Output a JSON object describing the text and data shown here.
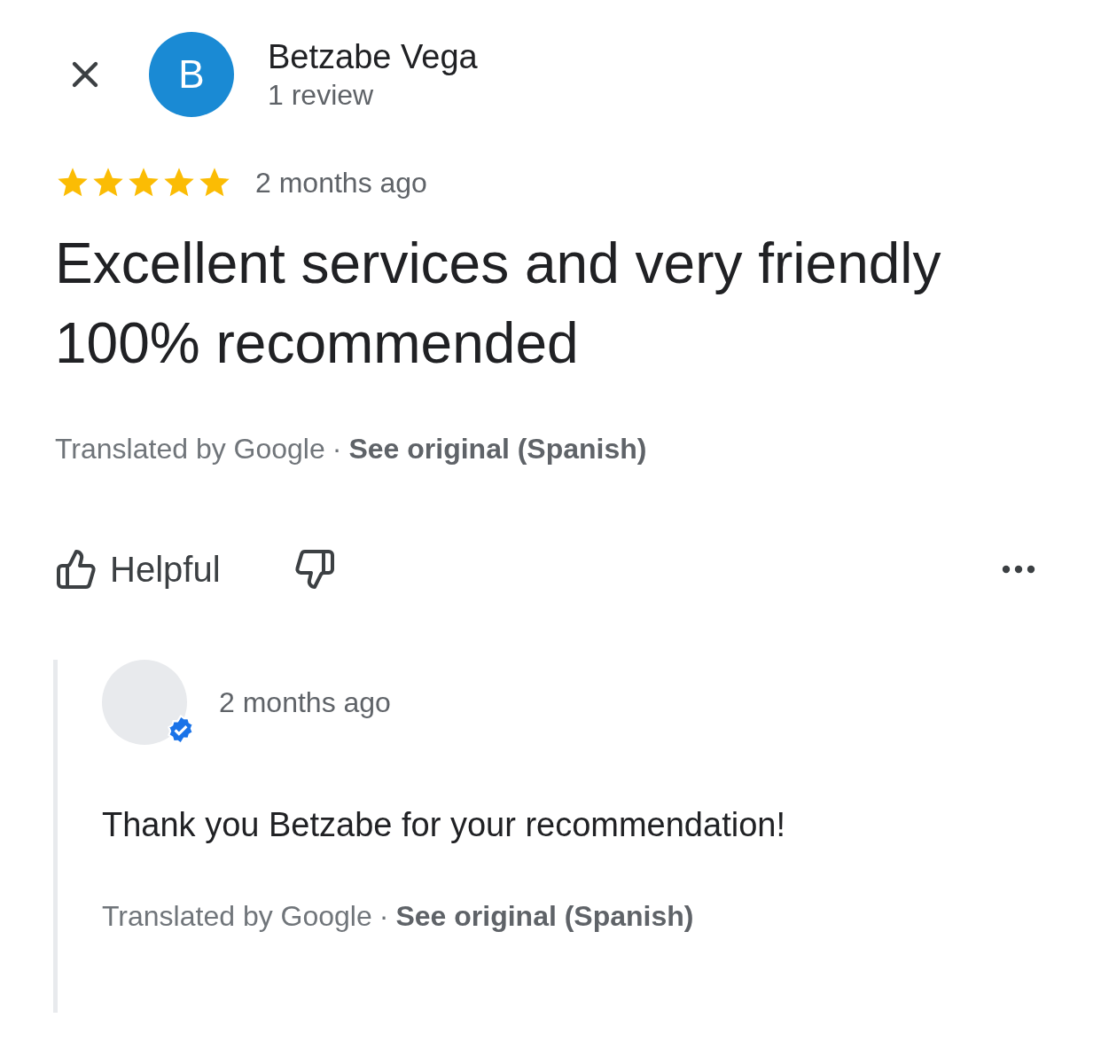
{
  "reviewer": {
    "initial": "B",
    "name": "Betzabe Vega",
    "review_count": "1 review"
  },
  "review": {
    "stars": 5,
    "time": "2 months ago",
    "text": "Excellent services and very friendly 100% recommended",
    "translation": {
      "label": "Translated by Google",
      "separator": "·",
      "link": "See original (Spanish)"
    }
  },
  "actions": {
    "helpful": "Helpful"
  },
  "reply": {
    "verified": true,
    "time": "2 months ago",
    "text": "Thank you Betzabe for your recommendation!",
    "translation": {
      "label": "Translated by Google",
      "separator": "·",
      "link": "See original (Spanish)"
    }
  }
}
